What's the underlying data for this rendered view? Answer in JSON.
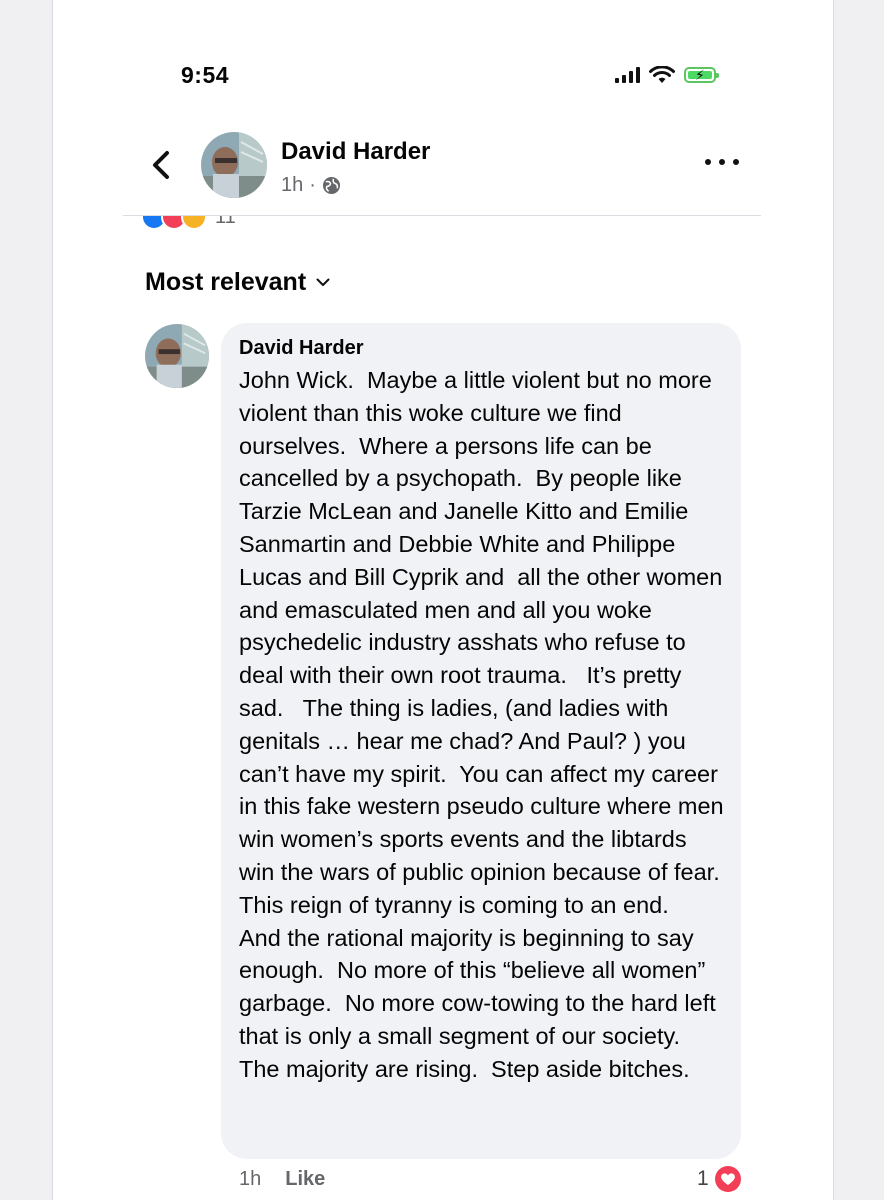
{
  "status_bar": {
    "time": "9:54"
  },
  "header": {
    "author": "David Harder",
    "age": "1h",
    "separator": "·"
  },
  "reactions": {
    "count": "11"
  },
  "sort": {
    "label": "Most relevant"
  },
  "comment": {
    "author": "David Harder",
    "text": "John Wick.  Maybe a little violent but no more violent than this woke culture we find ourselves.  Where a persons life can be cancelled by a psychopath.  By people like Tarzie McLean and Janelle Kitto and Emilie Sanmartin and Debbie White and Philippe Lucas and Bill Cyprik and  all the other women and emasculated men and all you woke psychedelic industry asshats who refuse to deal with their own root trauma.   It’s pretty sad.   The thing is ladies, (and ladies with genitals … hear me chad? And Paul? ) you can’t have my spirit.  You can affect my career in this fake western pseudo culture where men win women’s sports events and the libtards win the wars of public opinion because of fear.   This reign of tyranny is coming to an end.   And the rational majority is beginning to say enough.  No more of this “believe all women” garbage.  No more cow-towing to the hard left that is only a small segment of our society.  The majority are rising.  Step aside bitches.",
    "age": "1h",
    "like_label": "Like",
    "reaction_count": "1"
  },
  "colors": {
    "like_blue": "#1877f2",
    "love_red": "#f33e58",
    "care_yellow": "#f7b125",
    "bubble_bg": "#f0f2f5",
    "meta_gray": "#65676b"
  }
}
